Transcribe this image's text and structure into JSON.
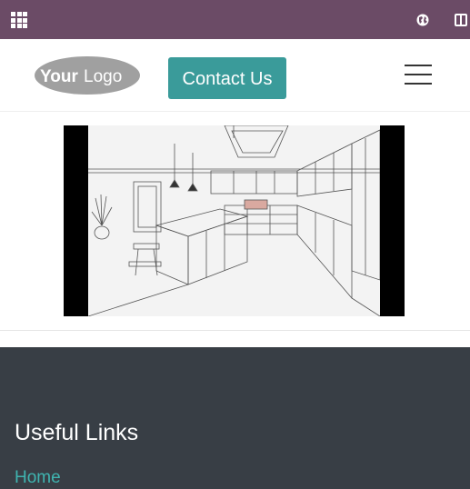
{
  "topbar": {
    "apps_icon": "apps-grid-icon",
    "globe_icon": "globe-icon",
    "split_icon": "split-view-icon",
    "color": "#6b4b66"
  },
  "header": {
    "logo_text_bold": "Your",
    "logo_text_light": "Logo",
    "contact_button": "Contact Us",
    "menu_icon": "hamburger-menu-icon",
    "accent": "#3a9b9a"
  },
  "media": {
    "description_icon": "kitchen-sketch-image"
  },
  "footer": {
    "background": "#383e45",
    "heading": "Useful Links",
    "links": [
      {
        "label": "Home"
      }
    ],
    "link_color": "#3fb4b0"
  }
}
